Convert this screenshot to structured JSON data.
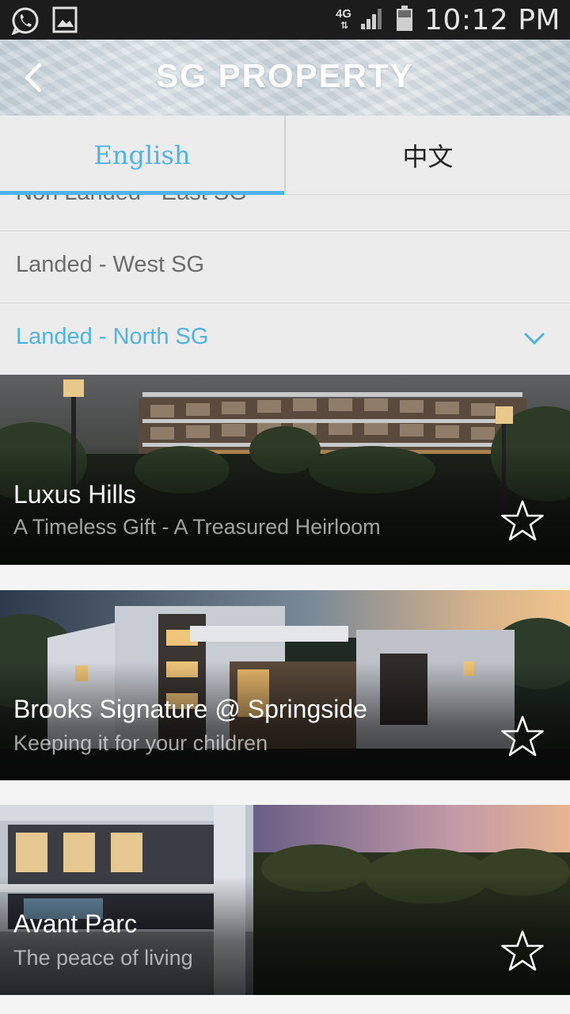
{
  "status_bar": {
    "network": "4G",
    "time": "10:12 PM",
    "icons": [
      "whatsapp-icon",
      "image-icon",
      "signal-icon",
      "battery-icon"
    ]
  },
  "header": {
    "title": "SG PROPERTY",
    "back_icon": "chevron-left-icon"
  },
  "tabs": [
    {
      "label": "English",
      "selected": true
    },
    {
      "label": "中文",
      "selected": false
    }
  ],
  "categories": [
    {
      "label": "Non Landed - East SG",
      "selected": false
    },
    {
      "label": "Landed - West SG",
      "selected": false
    },
    {
      "label": "Landed - North SG",
      "selected": true
    }
  ],
  "properties": [
    {
      "name": "Luxus Hills",
      "tagline": "A Timeless Gift - A Treasured Heirloom",
      "favorite": false
    },
    {
      "name": "Brooks Signature @ Springside",
      "tagline": "Keeping it for your children",
      "favorite": false
    },
    {
      "name": "Avant Parc",
      "tagline": "The peace of living",
      "favorite": false
    }
  ],
  "colors": {
    "accent": "#4fb3e8",
    "status_bar": "#1c1c1c",
    "list_background": "#ececec"
  }
}
